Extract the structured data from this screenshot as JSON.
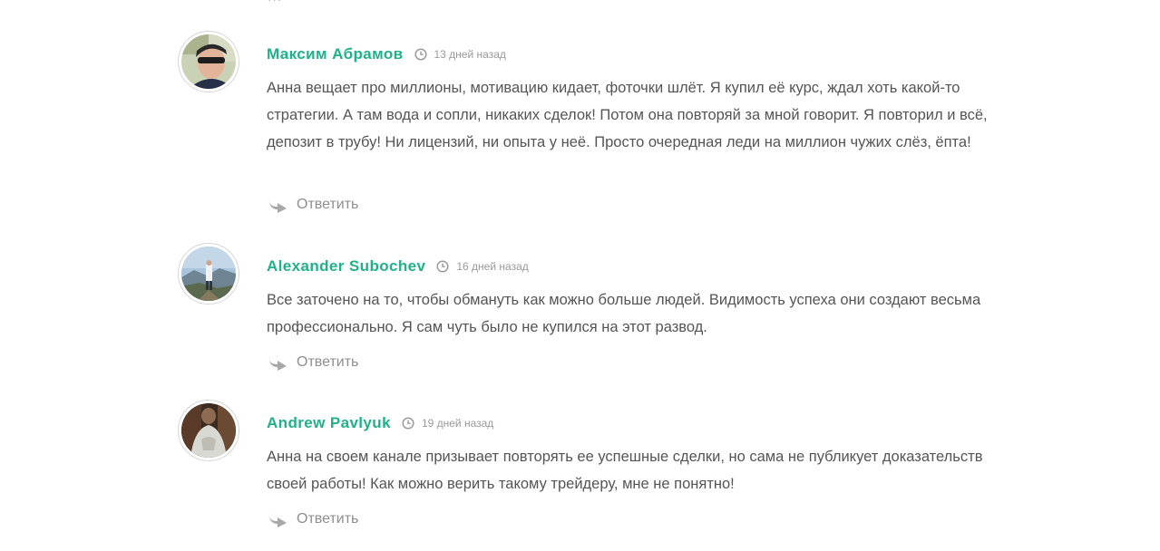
{
  "top_fragment": "…",
  "comments": [
    {
      "author": "Максим Абрамов",
      "time": "13 дней назад",
      "text": "Анна вещает про миллионы, мотивацию кидает, фоточки шлёт. Я купил её курс, ждал хоть какой-то стратегии. А там вода и сопли, никаких сделок! Потом она повторяй за мной говорит. Я повторил и всё, депозит в трубу! Ни лицензий, ни опыта у неё. Просто очередная леди на миллион чужих слёз, ёпта!",
      "reply_label": "Ответить"
    },
    {
      "author": "Alexander Subochev",
      "time": "16 дней назад",
      "text": "Все заточено на то, чтобы обмануть как можно больше людей. Видимость успеха они создают весьма профессионально. Я сам чуть было не купился на этот развод.",
      "reply_label": "Ответить"
    },
    {
      "author": "Andrew Pavlyuk",
      "time": "19 дней назад",
      "text": "Анна на своем канале призывает повторять ее успешные сделки, но сама не публикует доказательств своей работы! Как можно верить такому трейдеру, мне не понятно!",
      "reply_label": "Ответить"
    }
  ],
  "colors": {
    "author": "#20b18a",
    "text": "#555555",
    "muted": "#9a9a9a"
  },
  "icons": {
    "time": "clock-icon",
    "reply": "reply-arrow-icon"
  }
}
